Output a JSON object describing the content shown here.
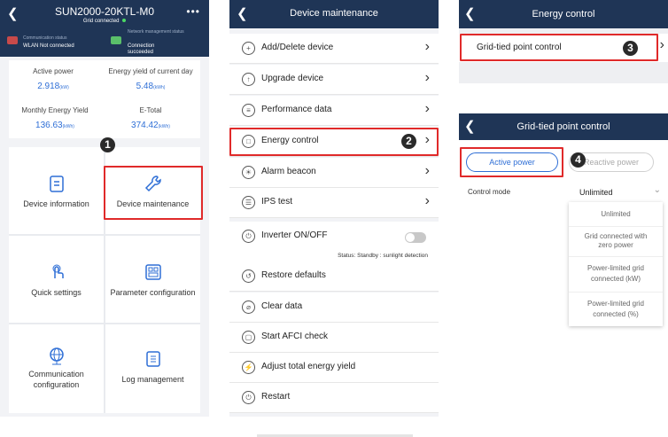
{
  "panel1": {
    "title": "SUN2000-20KTL-M0",
    "subtitle": "Grid connected",
    "menu_icon": "more-icon",
    "comm_status_label": "Communication status",
    "comm_status_value": "WLAN Not connected",
    "nms_label": "Network management status",
    "nms_value": "Connection succeeded",
    "stats": [
      {
        "label": "Active power",
        "value": "2.918",
        "unit": "(kW)"
      },
      {
        "label": "Energy yield of current day",
        "value": "5.48",
        "unit": "(kWh)"
      },
      {
        "label": "Monthly Energy Yield",
        "value": "136.63",
        "unit": "(kWh)"
      },
      {
        "label": "E-Total",
        "value": "374.42",
        "unit": "(kWh)"
      }
    ],
    "tiles": [
      {
        "label": "Device information",
        "icon": "document-icon"
      },
      {
        "label": "Device maintenance",
        "icon": "wrench-icon"
      },
      {
        "label": "Quick settings",
        "icon": "touch-icon"
      },
      {
        "label": "Parameter configuration",
        "icon": "grid-config-icon"
      },
      {
        "label": "Communication configuration",
        "icon": "globe-icon"
      },
      {
        "label": "Log management",
        "icon": "log-icon"
      }
    ],
    "step_badge": "1"
  },
  "panel2": {
    "title": "Device maintenance",
    "items": [
      {
        "label": "Add/Delete device",
        "icon": "plus-icon"
      },
      {
        "label": "Upgrade device",
        "icon": "upload-icon"
      },
      {
        "label": "Performance data",
        "icon": "chart-icon"
      },
      {
        "label": "Energy control",
        "icon": "energy-icon"
      },
      {
        "label": "Alarm beacon",
        "icon": "alarm-icon"
      },
      {
        "label": "IPS test",
        "icon": "ips-icon"
      },
      {
        "label": "Inverter ON/OFF",
        "icon": "power-icon"
      },
      {
        "label": "Restore defaults",
        "icon": "restore-icon"
      },
      {
        "label": "Clear data",
        "icon": "clear-icon"
      },
      {
        "label": "Start AFCI check",
        "icon": "afci-icon"
      },
      {
        "label": "Adjust total energy yield",
        "icon": "adjust-icon"
      },
      {
        "label": "Restart",
        "icon": "restart-icon"
      }
    ],
    "inverter_status": "Status: Standby : sunlight detection",
    "step_badge": "2"
  },
  "panel3": {
    "title": "Energy control",
    "item": "Grid-tied point control",
    "step_badge": "3"
  },
  "panel4": {
    "title": "Grid-tied point control",
    "tab_active": "Active power",
    "tab_reactive": "Reactive power",
    "control_mode_label": "Control mode",
    "control_mode_value": "Unlimited",
    "options": [
      "Unlimited",
      "Grid connected with zero power",
      "Power-limited grid connected (kW)",
      "Power-limited grid connected (%)"
    ],
    "step_badge": "4"
  },
  "colors": {
    "navbar": "#1f3556",
    "accent": "#2f6fd6",
    "highlight": "#e02a2a"
  }
}
